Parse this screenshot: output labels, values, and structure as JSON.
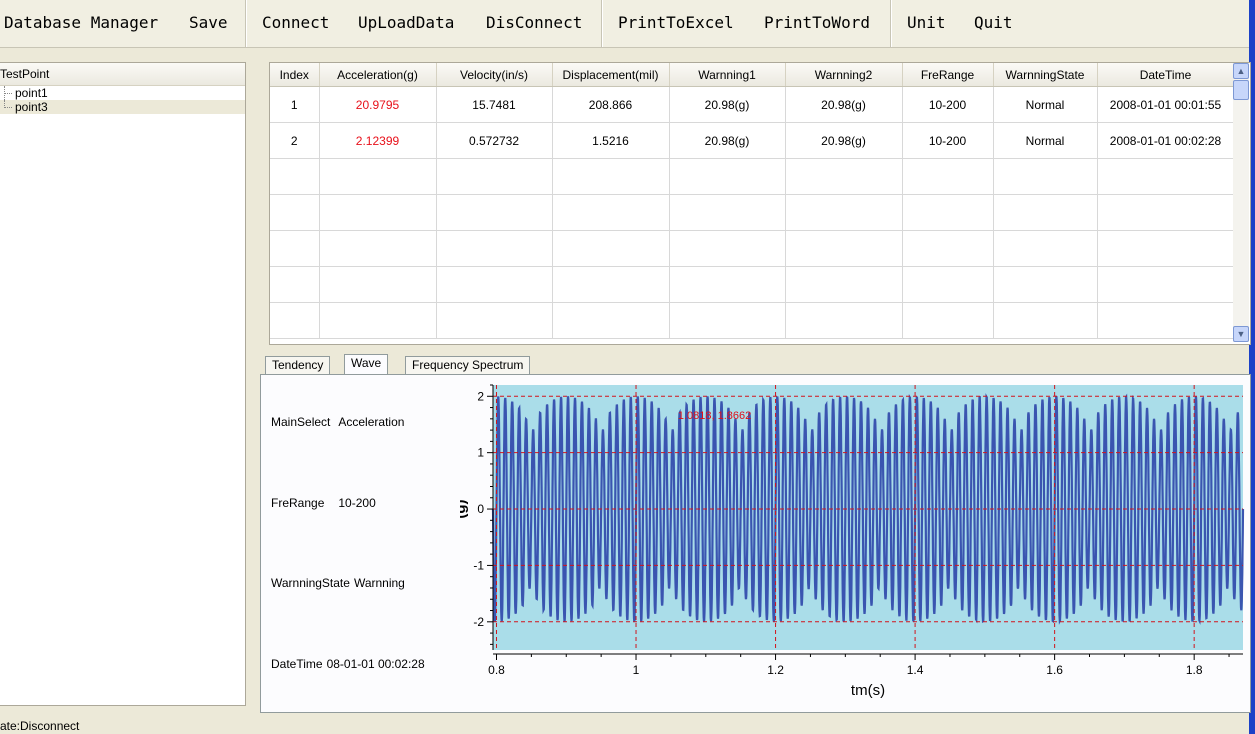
{
  "menu": {
    "items": [
      "Database Manager",
      "Save",
      "Connect",
      "UpLoadData",
      "DisConnect",
      "PrintToExcel",
      "PrintToWord",
      "Unit",
      "Quit"
    ]
  },
  "tree": {
    "header": "TestPoint",
    "items": [
      "point1",
      "point3"
    ],
    "selected": "point3"
  },
  "status": {
    "text": "ate:Disconnect"
  },
  "table": {
    "columns": [
      "Index",
      "Acceleration(g)",
      "Velocity(in/s)",
      "Displacement(mil)",
      "Warnning1",
      "Warnning2",
      "FreRange",
      "WarnningState",
      "DateTime"
    ],
    "rows": [
      [
        "1",
        "20.9795",
        "15.7481",
        "208.866",
        "20.98(g)",
        "20.98(g)",
        "10-200",
        "Normal",
        "2008-01-01 00:01:55"
      ],
      [
        "2",
        "2.12399",
        "0.572732",
        "1.5216",
        "20.98(g)",
        "20.98(g)",
        "10-200",
        "Normal",
        "2008-01-01 00:02:28"
      ]
    ],
    "empty_rows": 5,
    "highlight_color": "#e8101a"
  },
  "tabs": {
    "items": [
      "Tendency",
      "Wave",
      "Frequency Spectrum"
    ],
    "active": "Wave"
  },
  "info": {
    "main_select_label": "MainSelect",
    "main_select_value": "Acceleration",
    "fre_range_label": "FreRange",
    "fre_range_value": "10-200",
    "state_label": "WarnningState",
    "state_value": "Warnning",
    "datetime_label": "DateTime",
    "datetime_value": "08-01-01 00:02:28"
  },
  "chart_data": {
    "type": "line",
    "xlabel": "tm(s)",
    "ylabel": "(g)",
    "xlim": [
      0.795,
      1.87
    ],
    "ylim": [
      -2.5,
      2.2
    ],
    "xticks": [
      0.8,
      1,
      1.2,
      1.4,
      1.6,
      1.8
    ],
    "yticks": [
      -2,
      -1,
      0,
      1,
      2
    ],
    "annotation": "1.0818, 1.8662",
    "amplitude": 2.0,
    "carrier_cycles_per_s": 100,
    "envelope_period_s": 0.1,
    "grid": "dashed",
    "colors": {
      "plot_bg": "#aadde9",
      "line": "#3a55b0",
      "grid": "#d1141c"
    }
  }
}
